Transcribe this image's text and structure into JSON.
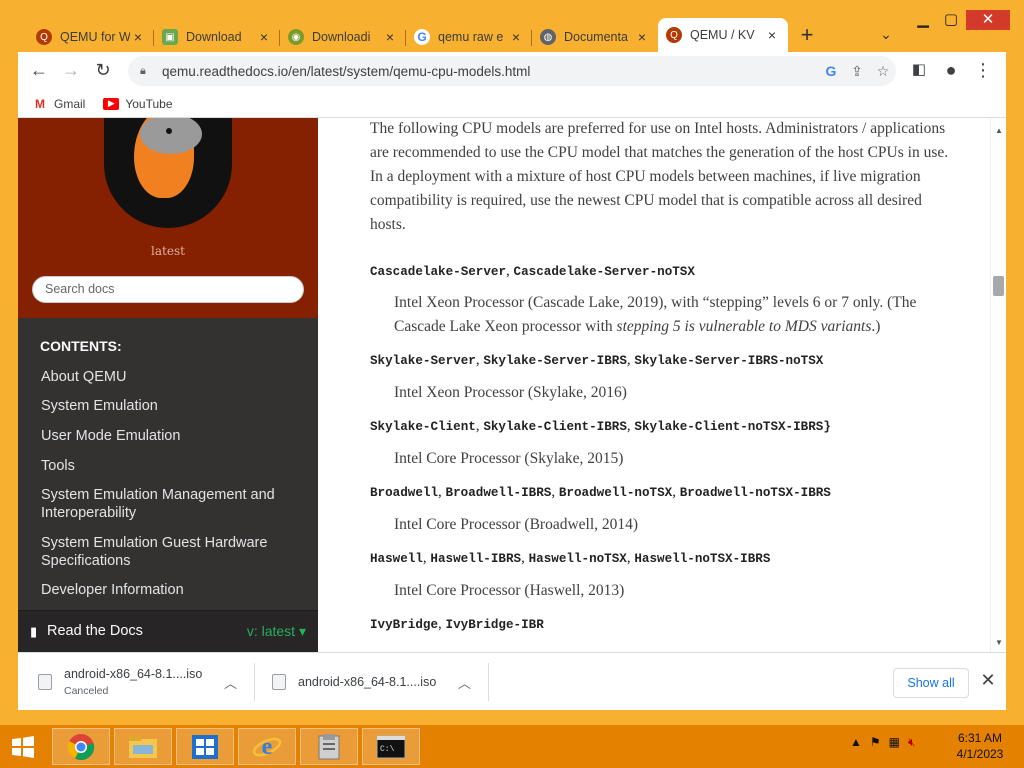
{
  "browser": {
    "tabs": [
      {
        "title": "QEMU for W",
        "icon": "qemu-icon"
      },
      {
        "title": "Download",
        "icon": "android-icon"
      },
      {
        "title": "Downloadi",
        "icon": "download-site-icon"
      },
      {
        "title": "qemu raw e",
        "icon": "google-icon"
      },
      {
        "title": "Documenta",
        "icon": "globe-icon"
      },
      {
        "title": "QEMU / KV",
        "icon": "qemu-icon",
        "active": true
      }
    ],
    "url": "qemu.readthedocs.io/en/latest/system/qemu-cpu-models.html",
    "bookmarks": [
      {
        "label": "Gmail",
        "icon": "gmail-icon"
      },
      {
        "label": "YouTube",
        "icon": "youtube-icon"
      }
    ]
  },
  "sidebar": {
    "version": "latest",
    "search_placeholder": "Search docs",
    "contents_heading": "CONTENTS:",
    "items": [
      "About QEMU",
      "System Emulation",
      "User Mode Emulation",
      "Tools",
      "System Emulation Management and Interoperability",
      "System Emulation Guest Hardware Specifications",
      "Developer Information"
    ],
    "rtd_label": "Read the Docs",
    "rtd_version": "v: latest"
  },
  "content": {
    "intro": "The following CPU models are preferred for use on Intel hosts. Administrators / applications are recommended to use the CPU model that matches the generation of the host CPUs in use. In a deployment with a mixture of host CPU models between machines, if live migration compatibility is required, use the newest CPU model that is compatible across all desired hosts.",
    "entries": [
      {
        "models": [
          "Cascadelake-Server",
          "Cascadelake-Server-noTSX"
        ],
        "desc": "Intel Xeon Processor (Cascade Lake, 2019), with “stepping” levels 6 or 7 only. (The Cascade Lake Xeon processor with ",
        "desc_em": "stepping 5 is vulnerable to MDS variants",
        "desc_tail": ".)"
      },
      {
        "models": [
          "Skylake-Server",
          "Skylake-Server-IBRS",
          "Skylake-Server-IBRS-noTSX"
        ],
        "desc": "Intel Xeon Processor (Skylake, 2016)"
      },
      {
        "models": [
          "Skylake-Client",
          "Skylake-Client-IBRS",
          "Skylake-Client-noTSX-IBRS}"
        ],
        "desc": "Intel Core Processor (Skylake, 2015)"
      },
      {
        "models": [
          "Broadwell",
          "Broadwell-IBRS",
          "Broadwell-noTSX",
          "Broadwell-noTSX-IBRS"
        ],
        "desc": "Intel Core Processor (Broadwell, 2014)"
      },
      {
        "models": [
          "Haswell",
          "Haswell-IBRS",
          "Haswell-noTSX",
          "Haswell-noTSX-IBRS"
        ],
        "desc": "Intel Core Processor (Haswell, 2013)"
      },
      {
        "models": [
          "IvyBridge",
          "IvyBridge-IBR"
        ],
        "desc": ""
      }
    ]
  },
  "downloads": {
    "items": [
      {
        "name": "android-x86_64-8.1....iso",
        "status": "Canceled"
      },
      {
        "name": "android-x86_64-8.1....iso",
        "status": ""
      }
    ],
    "show_all": "Show all"
  },
  "taskbar": {
    "time": "6:31 AM",
    "date": "4/1/2023"
  },
  "colors": {
    "sidebar_top": "#852000",
    "sidebar_bg": "#343131",
    "accent_green": "#27ae60",
    "window_frame": "#f8b030",
    "taskbar": "#e48100"
  }
}
